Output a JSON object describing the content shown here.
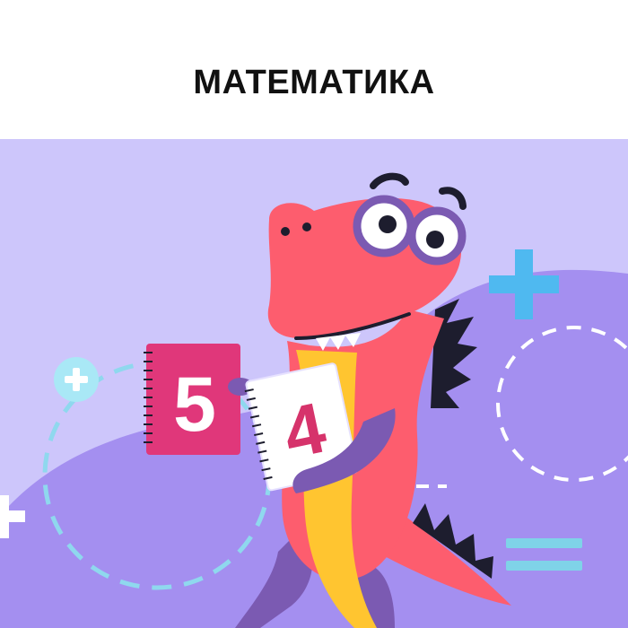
{
  "page": {
    "title": "МАТЕМАТИКА"
  },
  "illustration": {
    "notebook_left_digit": "5",
    "notebook_right_digit": "4",
    "colors": {
      "background": "#cdc6fb",
      "hill": "#a48ff0",
      "dino_body": "#fd5d6e",
      "dino_belly": "#ffc530",
      "dino_arms_legs": "#7b5ab2",
      "spikes": "#1d1d2e",
      "notebook_left": "#e0377a",
      "notebook_right": "#ffffff",
      "digit_color": "#d6336b",
      "accent_blue": "#4fb9f0",
      "accent_light_blue": "#a9e8f6"
    }
  }
}
